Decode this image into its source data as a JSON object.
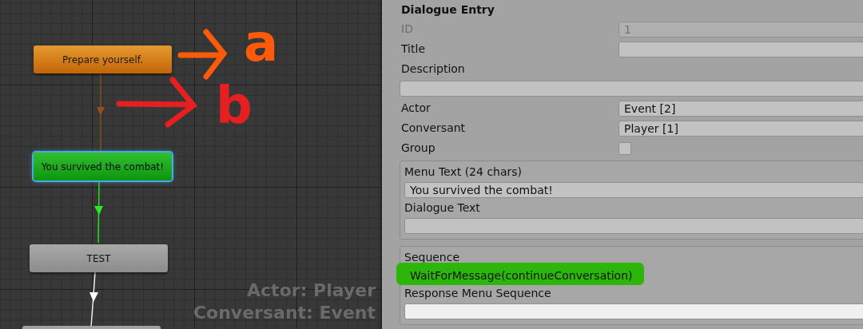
{
  "canvas": {
    "nodes": [
      {
        "kind": "orange",
        "label": "Prepare yourself.",
        "selected": false
      },
      {
        "kind": "green",
        "label": "You survived the combat!",
        "selected": true
      },
      {
        "kind": "gray",
        "label": "TEST",
        "selected": false
      }
    ],
    "annotations": [
      {
        "letter": "a",
        "color": "#ff5a0a"
      },
      {
        "letter": "b",
        "color": "#e62020"
      }
    ],
    "overlay": [
      "Actor: Player",
      "Conversant: Event"
    ]
  },
  "inspector": {
    "title": "Dialogue Entry",
    "fields": [
      {
        "kind": "text",
        "label": "ID",
        "value": "1",
        "disabled": true
      },
      {
        "kind": "text",
        "label": "Title"
      },
      {
        "kind": "wide",
        "label": "Description"
      },
      {
        "kind": "dropdown",
        "label": "Actor",
        "value": "Event [2]"
      },
      {
        "kind": "dropdown",
        "label": "Conversant",
        "value": "Player [1]"
      },
      {
        "kind": "checkbox",
        "label": "Group",
        "checked": false
      }
    ],
    "groups": [
      [
        {
          "label": "Menu Text (24 chars)",
          "value": "You survived the combat!",
          "highlighted": false
        },
        {
          "label": "Dialogue Text",
          "highlighted": false
        }
      ],
      [
        {
          "label": "Sequence",
          "value": "WaitForMessage(continueConversation)",
          "highlighted": true
        },
        {
          "label": "Response Menu Sequence",
          "highlighted": false
        }
      ]
    ]
  }
}
